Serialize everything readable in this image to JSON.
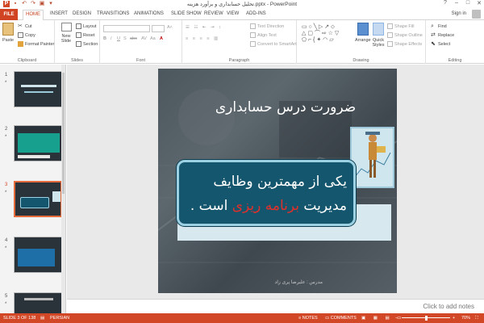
{
  "window": {
    "title": "تحلیل حسابداری و برآورد هزینه.pptx - PowerPoint",
    "controls": [
      "?",
      "–",
      "□",
      "✕"
    ]
  },
  "tabs": {
    "file": "FILE",
    "items": [
      "HOME",
      "INSERT",
      "DESIGN",
      "TRANSITIONS",
      "ANIMATIONS",
      "SLIDE SHOW",
      "REVIEW",
      "VIEW",
      "ADD-INS"
    ],
    "active": "HOME",
    "signin": "Sign in"
  },
  "ribbon": {
    "clipboard": {
      "label": "Clipboard",
      "paste": "Paste",
      "cut": "Cut",
      "copy": "Copy",
      "format_painter": "Format Painter"
    },
    "slides": {
      "label": "Slides",
      "new_slide": "New Slide",
      "layout": "Layout",
      "reset": "Reset",
      "section": "Section"
    },
    "font": {
      "label": "Font",
      "buttons": [
        "B",
        "I",
        "U",
        "S",
        "abc",
        "AV",
        "Aa",
        "A"
      ]
    },
    "paragraph": {
      "label": "Paragraph",
      "text_direction": "Text Direction",
      "align_text": "Align Text",
      "smartart": "Convert to SmartArt"
    },
    "drawing": {
      "label": "Drawing",
      "arrange": "Arrange",
      "quick_styles": "Quick Styles",
      "shape_fill": "Shape Fill",
      "shape_outline": "Shape Outline",
      "shape_effects": "Shape Effects"
    },
    "editing": {
      "label": "Editing",
      "find": "Find",
      "replace": "Replace",
      "select": "Select"
    }
  },
  "thumbnails": [
    {
      "num": "1",
      "star": "*"
    },
    {
      "num": "2",
      "star": "*"
    },
    {
      "num": "3",
      "star": "*"
    },
    {
      "num": "4",
      "star": "*"
    },
    {
      "num": "5",
      "star": "*"
    }
  ],
  "slide": {
    "title": "ضرورت درس حسابداری",
    "line1": "یکی  از  مهمترین  وظایف",
    "line2_pre": "مدیریت ",
    "line2_hl": "برنامه ریزی",
    "line2_post": " است .",
    "presenter": "مدرس : علیرضا پری زاد"
  },
  "notes": {
    "placeholder": "Click to add notes"
  },
  "status": {
    "slide": "SLIDE 3 OF 138",
    "language": "PERSIAN",
    "notes": "NOTES",
    "comments": "COMMENTS",
    "zoom": "70%"
  },
  "colors": {
    "accent": "#d24726",
    "callout": "#14566e",
    "highlight": "#e0302b"
  }
}
